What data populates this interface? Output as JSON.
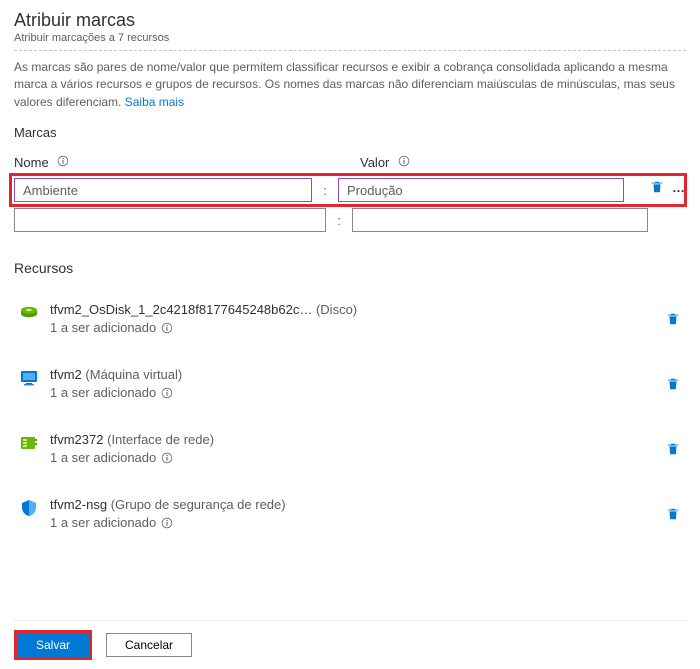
{
  "header": {
    "title": "Atribuir marcas",
    "subtitle": "Atribuir marcações a 7 recursos"
  },
  "description_text": "As marcas são pares de nome/valor que permitem classificar recursos e exibir a cobrança consolidada aplicando a mesma marca a vários recursos e grupos de recursos. Os nomes das marcas não diferenciam maiúsculas de minúsculas, mas seus valores diferenciam. ",
  "description_link": "Saiba mais",
  "tags": {
    "section_label": "Marcas",
    "name_label": "Nome",
    "value_label": "Valor",
    "colon": ":",
    "rows": [
      {
        "name": "Ambiente",
        "value": "Produção"
      },
      {
        "name": "",
        "value": ""
      }
    ]
  },
  "resources": {
    "section_label": "Recursos",
    "items": [
      {
        "name": "tfvm2_OsDisk_1_2c4218f8177645248b62c…",
        "type": "(Disco)",
        "sub": "1 a ser adicionado",
        "icon": "disk"
      },
      {
        "name": "tfvm2",
        "type": "(Máquina virtual)",
        "sub": "1 a ser adicionado",
        "icon": "vm"
      },
      {
        "name": "tfvm2372",
        "type": "(Interface de rede)",
        "sub": "1 a ser adicionado",
        "icon": "nic"
      },
      {
        "name": "tfvm2-nsg",
        "type": "(Grupo de segurança de rede)",
        "sub": "1 a ser adicionado",
        "icon": "nsg"
      }
    ]
  },
  "footer": {
    "save": "Salvar",
    "cancel": "Cancelar"
  }
}
